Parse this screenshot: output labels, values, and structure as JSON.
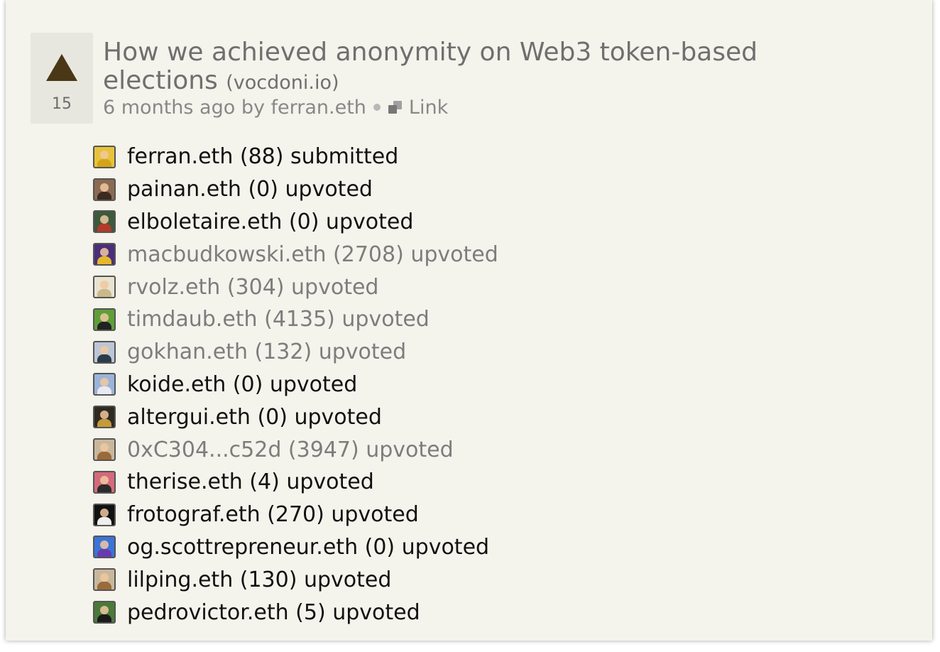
{
  "story": {
    "score": "15",
    "title": "How we achieved anonymity on Web3 token-based elections",
    "domain": "(vocdoni.io)",
    "meta": "6 months ago by ferran.eth",
    "link_label": "Link"
  },
  "voters": [
    {
      "text": "ferran.eth (88) submitted",
      "muted": false,
      "bg": "#e8c23a",
      "body": "#d4a418"
    },
    {
      "text": "painan.eth (0) upvoted",
      "muted": false,
      "bg": "#8a6a52",
      "body": "#3b2a20"
    },
    {
      "text": "elboletaire.eth (0) upvoted",
      "muted": false,
      "bg": "#3d5a3a",
      "body": "#b33a2a"
    },
    {
      "text": "macbudkowski.eth (2708) upvoted",
      "muted": true,
      "bg": "#4b2f7a",
      "body": "#e6b82a"
    },
    {
      "text": "rvolz.eth (304) upvoted",
      "muted": true,
      "bg": "#e9e2cf",
      "body": "#c9b98a"
    },
    {
      "text": "timdaub.eth (4135) upvoted",
      "muted": true,
      "bg": "#5f9e3a",
      "body": "#222222"
    },
    {
      "text": "gokhan.eth (132) upvoted",
      "muted": true,
      "bg": "#bcc6d4",
      "body": "#2a3a4a"
    },
    {
      "text": "koide.eth (0) upvoted",
      "muted": false,
      "bg": "#9bb4d8",
      "body": "#e9e9f2"
    },
    {
      "text": "altergui.eth (0) upvoted",
      "muted": false,
      "bg": "#2f2a20",
      "body": "#c69a3a"
    },
    {
      "text": "0xC304...c52d (3947) upvoted",
      "muted": true,
      "bg": "#c9b79c",
      "body": "#9b6a3a"
    },
    {
      "text": "therise.eth (4) upvoted",
      "muted": false,
      "bg": "#d46a7a",
      "body": "#2a2a2a"
    },
    {
      "text": "frotograf.eth (270) upvoted",
      "muted": false,
      "bg": "#111111",
      "body": "#eeeeee"
    },
    {
      "text": "og.scottrepreneur.eth (0) upvoted",
      "muted": false,
      "bg": "#3a74d8",
      "body": "#6a3ab0"
    },
    {
      "text": "lilping.eth (130) upvoted",
      "muted": false,
      "bg": "#c9b79c",
      "body": "#9b6a3a"
    },
    {
      "text": "pedrovictor.eth (5) upvoted",
      "muted": false,
      "bg": "#4a7a3a",
      "body": "#1a1a1a"
    }
  ]
}
